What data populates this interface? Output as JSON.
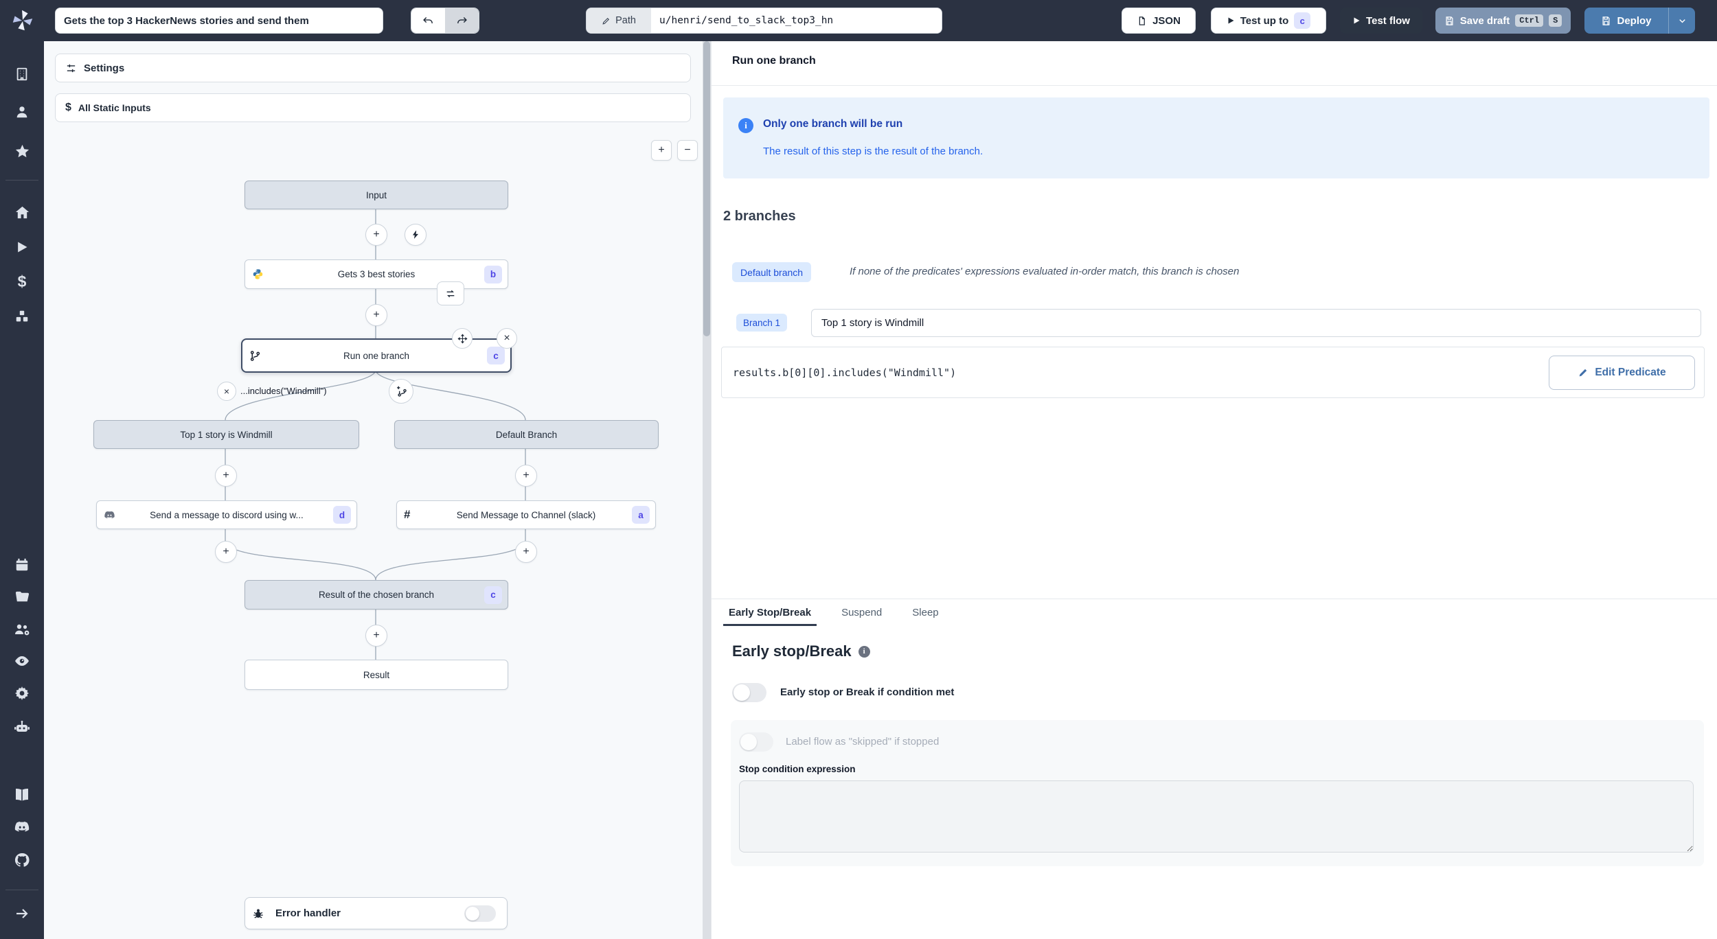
{
  "topbar": {
    "title_value": "Gets the top 3 HackerNews stories and send them",
    "path_label": "Path",
    "path_value": "u/henri/send_to_slack_top3_hn",
    "json_label": "JSON",
    "test_up_to_label": "Test up to",
    "test_up_to_badge": "c",
    "test_flow_label": "Test flow",
    "save_draft_label": "Save draft",
    "save_kbd_ctrl": "Ctrl",
    "save_kbd_s": "S",
    "deploy_label": "Deploy"
  },
  "sidebar": {
    "icons": [
      "windmill-logo",
      "building-icon",
      "user-icon",
      "star-icon",
      "home-icon",
      "play-icon",
      "dollar-icon",
      "cubes-icon",
      "calendar-icon",
      "folder-icon",
      "users-gear-icon",
      "eye-icon",
      "gear-icon",
      "robot-icon",
      "book-icon",
      "discord-icon",
      "github-icon",
      "arrow-right-icon"
    ]
  },
  "flow": {
    "settings_label": "Settings",
    "static_inputs_label": "All Static Inputs",
    "zoom_in": "+",
    "zoom_out": "−",
    "nodes": {
      "input": "Input",
      "gets_stories": {
        "label": "Gets 3 best stories",
        "badge": "b"
      },
      "run_one_branch": {
        "label": "Run one branch",
        "badge": "c"
      },
      "predicate_edge_label": "...includes(\"Windmill\")",
      "branch_left": "Top 1 story is Windmill",
      "branch_right": "Default Branch",
      "discord": {
        "label": "Send a message to discord using w...",
        "badge": "d"
      },
      "slack": {
        "label": "Send Message to Channel (slack)",
        "badge": "a"
      },
      "result_chosen": {
        "label": "Result of the chosen branch",
        "badge": "c"
      },
      "result": "Result",
      "error_handler": "Error handler"
    }
  },
  "panel": {
    "title": "Run one branch",
    "info_title": "Only one branch will be run",
    "info_body": "The result of this step is the result of the branch.",
    "branches_heading": "2 branches",
    "default_branch_badge": "Default branch",
    "default_branch_desc": "If none of the predicates' expressions evaluated in-order match, this branch is chosen",
    "branch1_badge": "Branch 1",
    "branch1_value": "Top 1 story is Windmill",
    "predicate_code": "results.b[0][0].includes(\"Windmill\")",
    "edit_predicate_label": "Edit Predicate",
    "tabs": [
      {
        "label": "Early Stop/Break",
        "active": true
      },
      {
        "label": "Suspend",
        "active": false
      },
      {
        "label": "Sleep",
        "active": false
      }
    ],
    "early_stop_heading": "Early stop/Break",
    "early_stop_toggle_label": "Early stop or Break if condition met",
    "skipped_toggle_label": "Label flow as \"skipped\" if stopped",
    "stop_condition_label": "Stop condition expression"
  },
  "colors": {
    "dark_surface": "#2b3242",
    "deploy_blue": "#4b7bae",
    "save_slate": "#7e94b1",
    "badge_indigo_text": "#4f46e5",
    "badge_indigo_bg": "#e0e4fd",
    "info_box_bg": "#e9f2fc",
    "info_blue": "#1d4ed8",
    "node_gray": "#dce2ea",
    "canvas_bg": "#f7f9fb"
  }
}
